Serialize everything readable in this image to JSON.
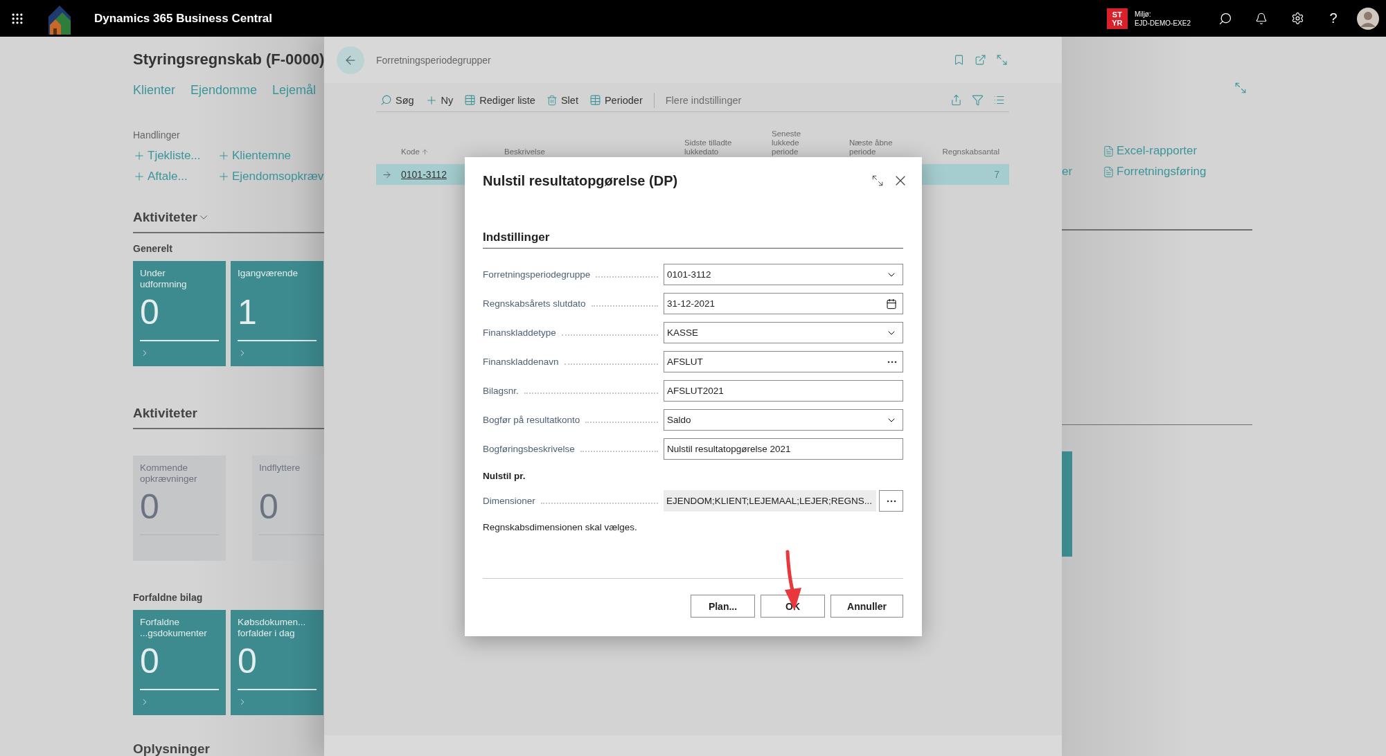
{
  "top_bar": {
    "app_title": "Dynamics 365 Business Central",
    "environment_badge": "ST\nYR",
    "environment_label": "Miljø:",
    "environment_name": "EJD-DEMO-EXE2",
    "help": "?"
  },
  "role_center": {
    "title": "Styringsregnskab (F-0000)",
    "nav_links": [
      "Klienter",
      "Ejendomme",
      "Lejemål"
    ],
    "actions_heading": "Handlinger",
    "actions": [
      "Tjekliste...",
      "Klientemne",
      "Aftale...",
      "Ejendomsopkræv"
    ],
    "sections": [
      {
        "heading": "Aktiviteter",
        "collapsible": true,
        "groups": [
          {
            "heading": "Generelt",
            "tiles": [
              {
                "title": "Under\nudformning",
                "value": "0",
                "kind": "accent"
              },
              {
                "title": "Igangværende",
                "value": "1",
                "kind": "accent"
              }
            ]
          }
        ]
      },
      {
        "heading": "Aktiviteter",
        "collapsible": false,
        "groups": [
          {
            "tiles": [
              {
                "title": "Kommende\nopkrævninger",
                "value": "0",
                "kind": "muted"
              },
              {
                "title": "Indflyttere",
                "value": "0",
                "kind": "muted"
              }
            ]
          },
          {
            "heading": "Forfaldne bilag",
            "tiles": [
              {
                "title": "Forfaldne\n...gsdokumenter",
                "value": "0",
                "kind": "accent"
              },
              {
                "title": "Købsdokumen...\nforfalder i dag",
                "value": "0",
                "kind": "accent"
              }
            ]
          }
        ]
      },
      {
        "heading": "Oplysninger",
        "collapsible": false
      }
    ],
    "right": {
      "cut_label": "er",
      "reports": [
        "Excel-rapporter",
        "Forretningsføring"
      ]
    }
  },
  "list_page": {
    "title": "Forretningsperiodegrupper",
    "toolbar": [
      {
        "label": "Søg",
        "kind": "search"
      },
      {
        "label": "Ny",
        "kind": "new"
      },
      {
        "label": "Rediger liste",
        "kind": "edit"
      },
      {
        "label": "Slet",
        "kind": "delete"
      },
      {
        "label": "Perioder",
        "kind": "periods"
      },
      {
        "label": "Flere indstillinger",
        "kind": "more"
      }
    ],
    "columns": [
      {
        "label": "Kode",
        "sorted": true
      },
      {
        "label": "Beskrivelse",
        "sorted": false
      },
      {
        "label": "Sidste tilladte lukkedato",
        "sorted": false
      },
      {
        "label": "Seneste lukkede periode",
        "sorted": false
      },
      {
        "label": "Næste åbne periode",
        "sorted": false
      },
      {
        "label": "Regnskabsantal",
        "sorted": false
      }
    ],
    "rows": [
      {
        "selected": true,
        "code": "0101-3112",
        "count": "7"
      }
    ]
  },
  "dialog": {
    "title": "Nulstil resultatopgørelse (DP)",
    "section": "Indstillinger",
    "fields": [
      {
        "label": "Forretningsperiodegruppe",
        "value": "0101-3112",
        "kind": "dropdown"
      },
      {
        "label": "Regnskabsårets slutdato",
        "value": "31-12-2021",
        "kind": "date"
      },
      {
        "label": "Finanskladdetype",
        "value": "KASSE",
        "kind": "dropdown"
      },
      {
        "label": "Finanskladdenavn",
        "value": "AFSLUT",
        "kind": "lookup"
      },
      {
        "label": "Bilagsnr.",
        "value": "AFSLUT2021",
        "kind": "text"
      },
      {
        "label": "Bogfør på resultatkonto",
        "value": "Saldo",
        "kind": "dropdown"
      },
      {
        "label": "Bogføringsbeskrivelse",
        "value": "Nulstil resultatopgørelse 2021",
        "kind": "text"
      }
    ],
    "reset_heading": "Nulstil pr.",
    "reset_fields": [
      {
        "label": "Dimensioner",
        "value": "EJENDOM;KLIENT;LEJEMAAL;LEJER;REGNS...",
        "kind": "assist"
      }
    ],
    "note": "Regnskabsdimensionen skal vælges.",
    "buttons": [
      "Plan...",
      "OK",
      "Annuller"
    ]
  }
}
